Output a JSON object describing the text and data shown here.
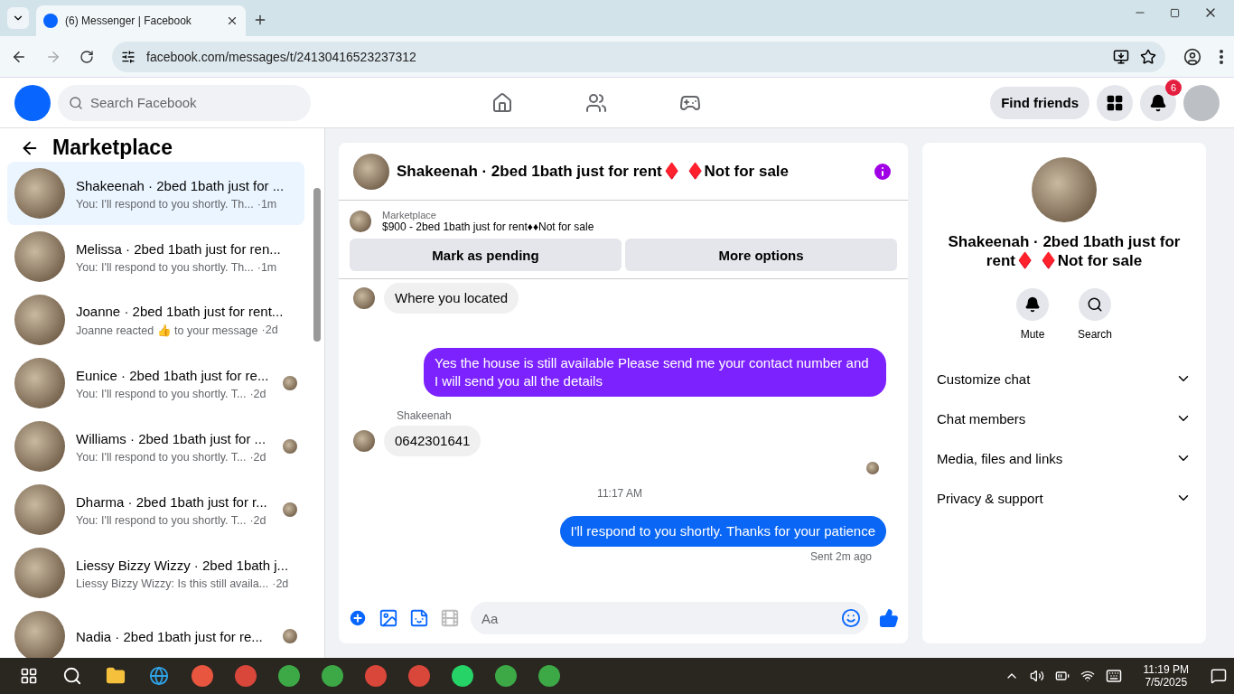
{
  "browser": {
    "tab_title": "(6) Messenger | Facebook",
    "url": "facebook.com/messages/t/24130416523237312"
  },
  "header": {
    "search_placeholder": "Search Facebook",
    "find_friends": "Find friends",
    "notification_count": "6"
  },
  "sidebar": {
    "title": "Marketplace",
    "conversations": [
      {
        "title": "Shakeenah · 2bed 1bath just for ...",
        "preview": "You: I'll respond to you shortly. Th...",
        "time": "·1m",
        "selected": true,
        "seen": false
      },
      {
        "title": "Melissa · 2bed 1bath just for ren...",
        "preview": "You: I'll respond to you shortly. Th...",
        "time": "·1m",
        "selected": false,
        "seen": false
      },
      {
        "title": "Joanne · 2bed 1bath just for rent...",
        "preview": "Joanne reacted 👍 to your message",
        "time": "·2d",
        "selected": false,
        "seen": false
      },
      {
        "title": "Eunice · 2bed 1bath just for re...",
        "preview": "You: I'll respond to you shortly. T...",
        "time": "·2d",
        "selected": false,
        "seen": true
      },
      {
        "title": "Williams · 2bed 1bath just for ...",
        "preview": "You: I'll respond to you shortly. T...",
        "time": "·2d",
        "selected": false,
        "seen": true
      },
      {
        "title": "Dharma · 2bed 1bath just for r...",
        "preview": "You: I'll respond to you shortly. T...",
        "time": "·2d",
        "selected": false,
        "seen": true
      },
      {
        "title": "Liessy Bizzy Wizzy · 2bed 1bath j...",
        "preview": "Liessy Bizzy Wizzy: Is this still availa...",
        "time": "·2d",
        "selected": false,
        "seen": false
      },
      {
        "title": "Nadia · 2bed 1bath just for re...",
        "selected": false,
        "seen": true
      }
    ]
  },
  "chat": {
    "title": "Shakeenah · 2bed 1bath just for rent♦️ ♦️Not for sale",
    "listing_label": "Marketplace",
    "listing": "$900 - 2bed 1bath just for rent♦♦Not for sale",
    "actions": [
      "Mark as pending",
      "More options"
    ],
    "messages": [
      {
        "kind": "incoming",
        "text": "Where you located"
      },
      {
        "kind": "outgoing",
        "text": "Yes the house is still available Please send me your contact number and I will send you all the details",
        "color": "#7c22ff"
      },
      {
        "kind": "sender",
        "text": "Shakeenah"
      },
      {
        "kind": "incoming",
        "text": "0642301641"
      },
      {
        "kind": "seen"
      },
      {
        "kind": "timestamp",
        "text": "11:17 AM"
      },
      {
        "kind": "outgoing",
        "text": "I'll respond to you shortly. Thanks for your patience",
        "color": "#0a66f5"
      },
      {
        "kind": "status",
        "text": "Sent 2m ago"
      }
    ],
    "composer_placeholder": "Aa"
  },
  "details": {
    "title": "Shakeenah · 2bed 1bath just for rent♦️ ♦️Not for sale",
    "actions": [
      "Mute",
      "Search"
    ],
    "sections": [
      "Customize chat",
      "Chat members",
      "Media, files and links",
      "Privacy & support"
    ]
  },
  "taskbar": {
    "time": "11:19 PM",
    "date": "7/5/2025"
  }
}
